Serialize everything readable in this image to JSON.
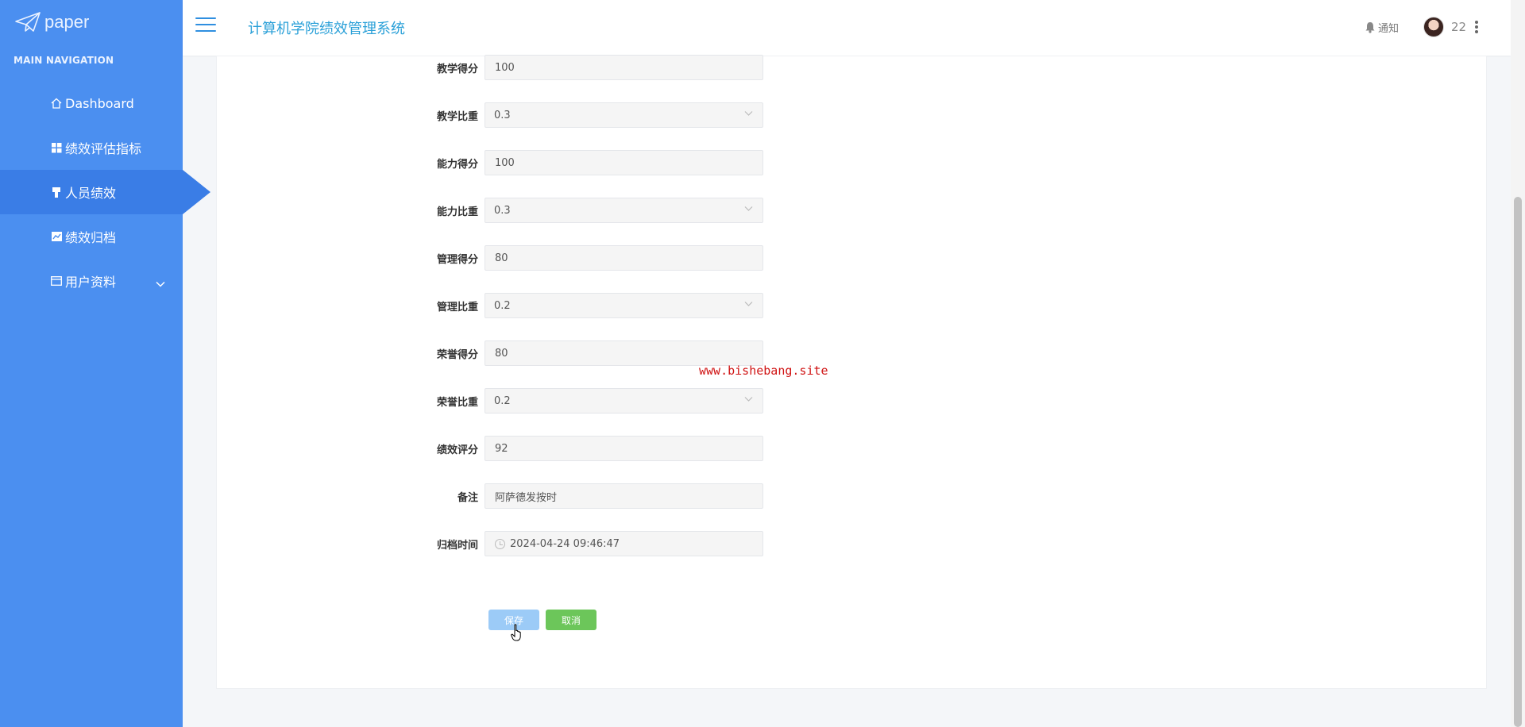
{
  "brand": {
    "logo_text": "paper"
  },
  "sidebar": {
    "section_title": "MAIN NAVIGATION",
    "items": [
      {
        "label": "Dashboard",
        "icon": "home-icon"
      },
      {
        "label": "绩效评估指标",
        "icon": "grid-icon"
      },
      {
        "label": "人员绩效",
        "icon": "person-icon",
        "active": true
      },
      {
        "label": "绩效归档",
        "icon": "chart-icon"
      },
      {
        "label": "用户资料",
        "icon": "card-icon",
        "has_submenu": true
      }
    ]
  },
  "header": {
    "title": "计算机学院绩效管理系统",
    "notice_label": "通知",
    "user_name": "22"
  },
  "form": {
    "fields": [
      {
        "label": "教学得分",
        "value": "100",
        "type": "input"
      },
      {
        "label": "教学比重",
        "value": "0.3",
        "type": "select"
      },
      {
        "label": "能力得分",
        "value": "100",
        "type": "input"
      },
      {
        "label": "能力比重",
        "value": "0.3",
        "type": "select"
      },
      {
        "label": "管理得分",
        "value": "80",
        "type": "input"
      },
      {
        "label": "管理比重",
        "value": "0.2",
        "type": "select"
      },
      {
        "label": "荣誉得分",
        "value": "80",
        "type": "input"
      },
      {
        "label": "荣誉比重",
        "value": "0.2",
        "type": "select"
      },
      {
        "label": "绩效评分",
        "value": "92",
        "type": "input"
      },
      {
        "label": "备注",
        "value": "阿萨德发按时",
        "type": "input"
      },
      {
        "label": "归档时间",
        "value": "2024-04-24 09:46:47",
        "type": "datetime"
      }
    ],
    "save_label": "保存",
    "cancel_label": "取消"
  },
  "watermark": "www.bishebang.site",
  "colors": {
    "sidebar": "#4b8ff0",
    "sidebar_active": "#3a7de6",
    "title": "#2aa0d8",
    "save": "#9ccbf7",
    "cancel": "#6cc65a",
    "watermark": "#d01414"
  }
}
